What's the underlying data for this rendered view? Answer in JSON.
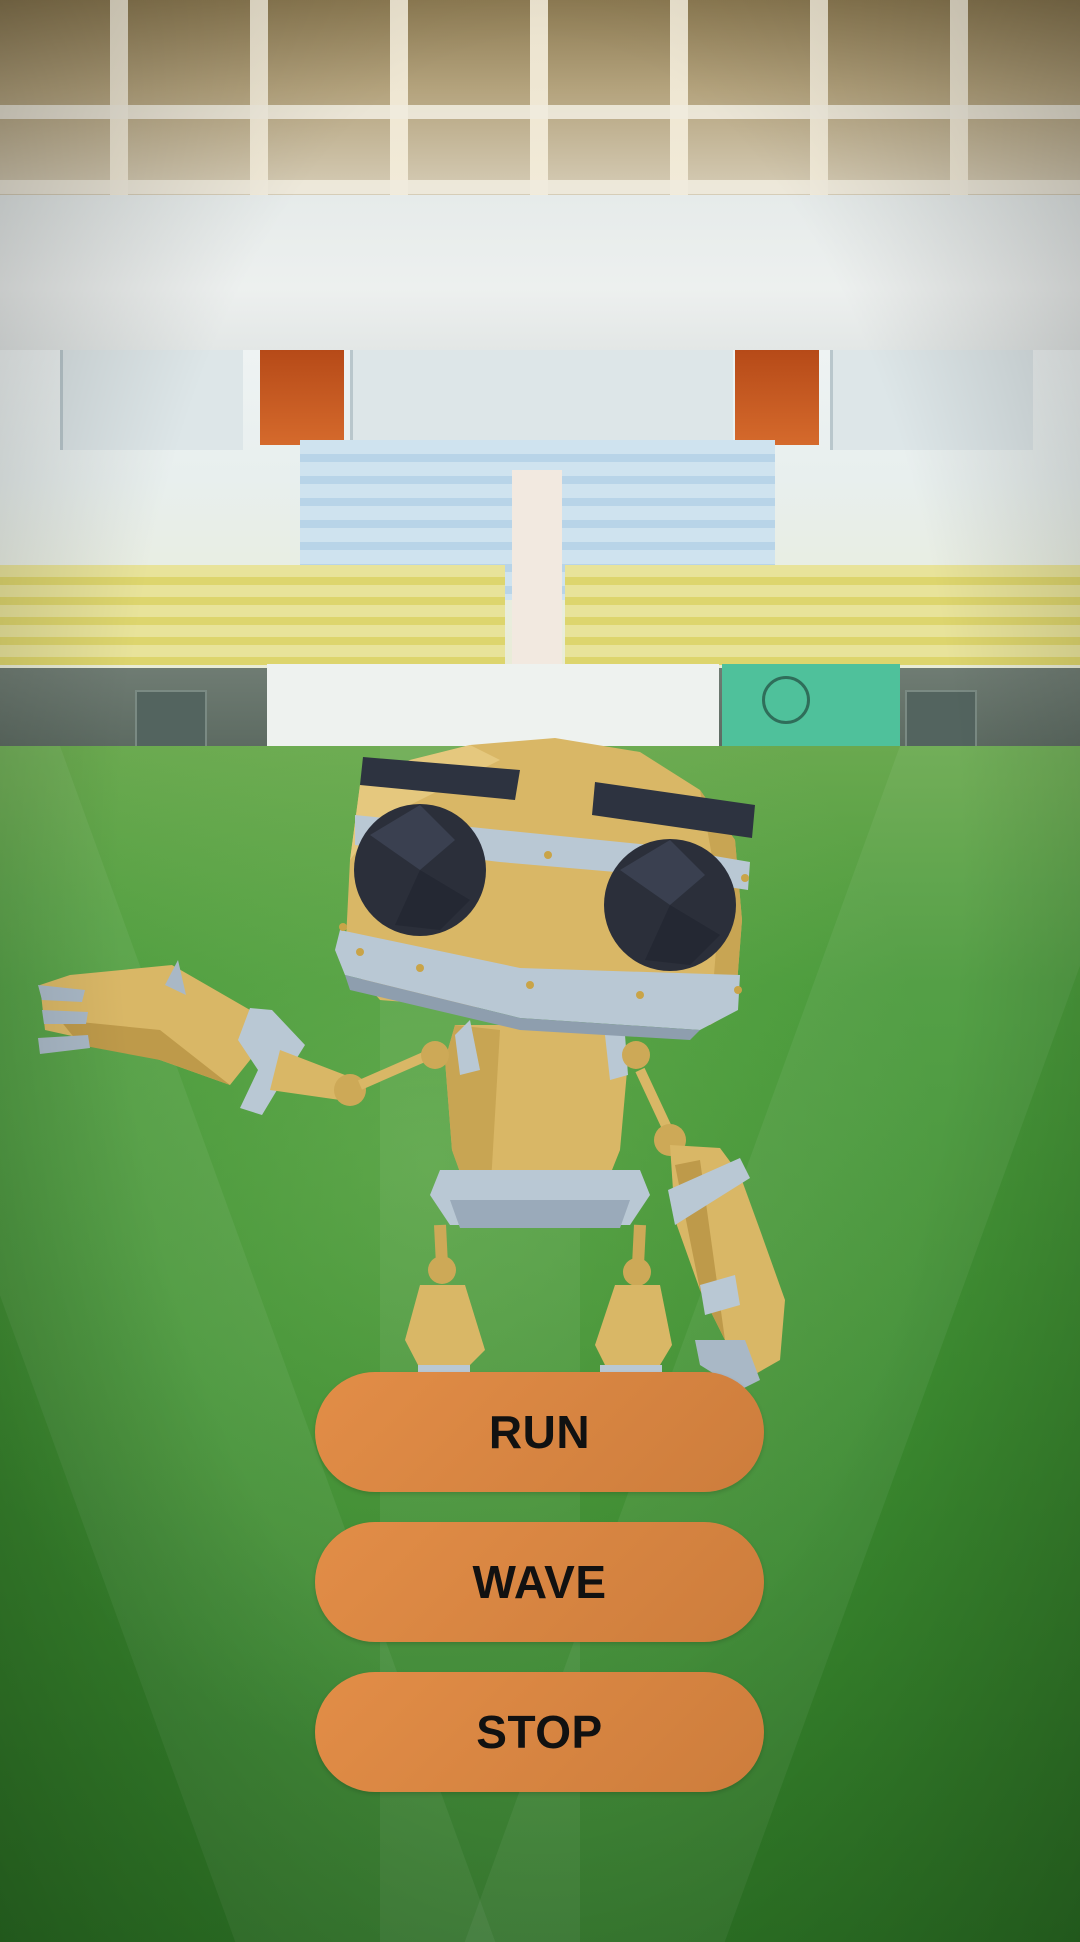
{
  "scene": {
    "background": "stadium-field-camera-view",
    "model": "yellow-robot"
  },
  "controls": {
    "run_label": "RUN",
    "wave_label": "WAVE",
    "stop_label": "STOP"
  },
  "colors": {
    "button_fill": "#D9863F",
    "button_text": "#111111",
    "robot_body": "#D4B25E",
    "robot_eyes": "#2B2F3A",
    "robot_trim": "#A9B8C6"
  }
}
